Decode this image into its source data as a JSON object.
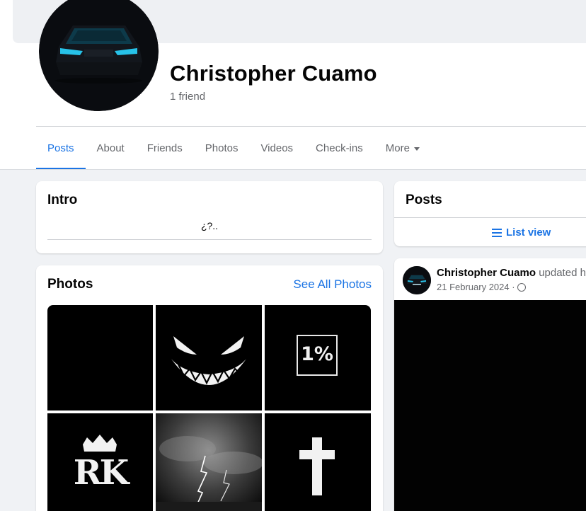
{
  "profile": {
    "name": "Christopher Cuamo",
    "friends_count": "1 friend"
  },
  "tabs": [
    {
      "label": "Posts"
    },
    {
      "label": "About"
    },
    {
      "label": "Friends"
    },
    {
      "label": "Photos"
    },
    {
      "label": "Videos"
    },
    {
      "label": "Check-ins"
    },
    {
      "label": "More"
    }
  ],
  "intro": {
    "title": "Intro",
    "bio": "¿?.."
  },
  "photos": {
    "title": "Photos",
    "see_all": "See All Photos",
    "items": [
      {
        "alt": "dark-photo"
      },
      {
        "alt": "grinning-face-photo"
      },
      {
        "alt": "one-percent-photo",
        "text": "1%"
      },
      {
        "alt": "rk-crown-logo-photo",
        "text": "RK"
      },
      {
        "alt": "lightning-storm-photo"
      },
      {
        "alt": "cross-photo"
      }
    ]
  },
  "posts_section": {
    "title": "Posts",
    "list_view_label": "List view"
  },
  "post": {
    "author": "Christopher Cuamo",
    "action": "updated his",
    "date": "21 February 2024 ·"
  },
  "colors": {
    "accent": "#1b74e4",
    "background": "#f0f2f5",
    "muted_text": "#65676b"
  }
}
